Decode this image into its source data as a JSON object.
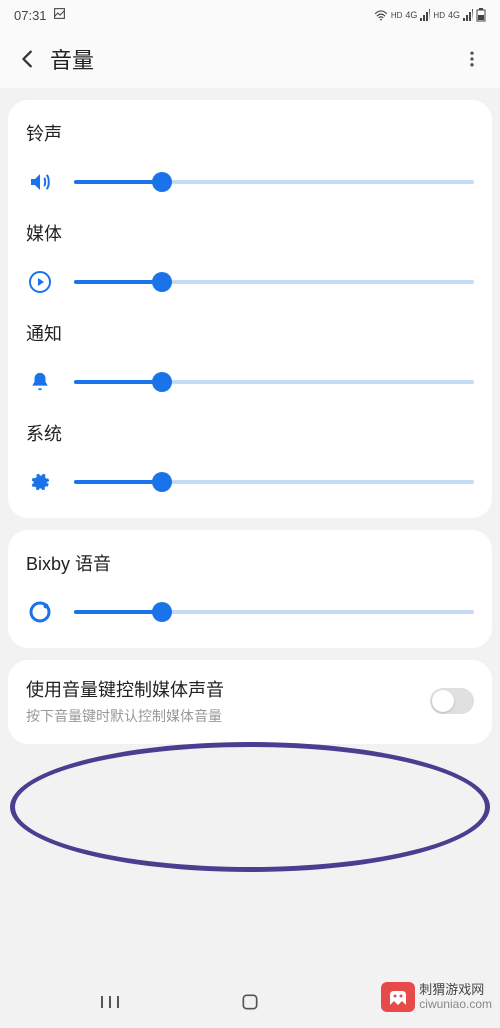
{
  "status": {
    "time": "07:31",
    "hd1": "HD",
    "g1": "4G",
    "hd2": "HD",
    "g2": "4G"
  },
  "header": {
    "title": "音量"
  },
  "sliders": {
    "ringtone": {
      "label": "铃声",
      "value": 22
    },
    "media": {
      "label": "媒体",
      "value": 22
    },
    "notification": {
      "label": "通知",
      "value": 22
    },
    "system": {
      "label": "系统",
      "value": 22
    },
    "bixby": {
      "label": "Bixby 语音",
      "value": 22
    }
  },
  "toggle": {
    "title": "使用音量键控制媒体声音",
    "sub": "按下音量键时默认控制媒体音量",
    "on": false
  },
  "watermark": {
    "line1": "刺猬游戏网",
    "line2": "ciwuniao.com"
  },
  "colors": {
    "accent": "#1a73e8",
    "track": "#c4dcf3"
  }
}
